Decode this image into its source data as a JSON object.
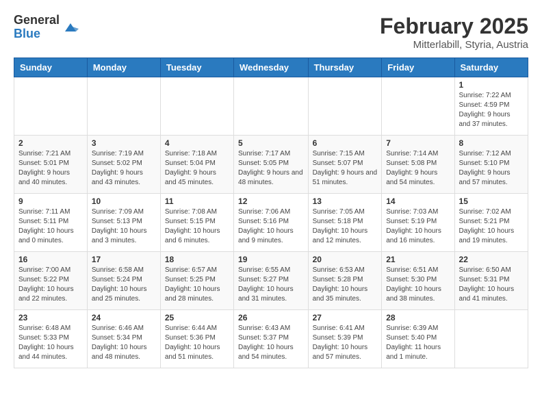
{
  "header": {
    "logo_general": "General",
    "logo_blue": "Blue",
    "month_year": "February 2025",
    "location": "Mitterlabill, Styria, Austria"
  },
  "weekdays": [
    "Sunday",
    "Monday",
    "Tuesday",
    "Wednesday",
    "Thursday",
    "Friday",
    "Saturday"
  ],
  "weeks": [
    [
      {
        "day": "",
        "info": ""
      },
      {
        "day": "",
        "info": ""
      },
      {
        "day": "",
        "info": ""
      },
      {
        "day": "",
        "info": ""
      },
      {
        "day": "",
        "info": ""
      },
      {
        "day": "",
        "info": ""
      },
      {
        "day": "1",
        "info": "Sunrise: 7:22 AM\nSunset: 4:59 PM\nDaylight: 9 hours and 37 minutes."
      }
    ],
    [
      {
        "day": "2",
        "info": "Sunrise: 7:21 AM\nSunset: 5:01 PM\nDaylight: 9 hours and 40 minutes."
      },
      {
        "day": "3",
        "info": "Sunrise: 7:19 AM\nSunset: 5:02 PM\nDaylight: 9 hours and 43 minutes."
      },
      {
        "day": "4",
        "info": "Sunrise: 7:18 AM\nSunset: 5:04 PM\nDaylight: 9 hours and 45 minutes."
      },
      {
        "day": "5",
        "info": "Sunrise: 7:17 AM\nSunset: 5:05 PM\nDaylight: 9 hours and 48 minutes."
      },
      {
        "day": "6",
        "info": "Sunrise: 7:15 AM\nSunset: 5:07 PM\nDaylight: 9 hours and 51 minutes."
      },
      {
        "day": "7",
        "info": "Sunrise: 7:14 AM\nSunset: 5:08 PM\nDaylight: 9 hours and 54 minutes."
      },
      {
        "day": "8",
        "info": "Sunrise: 7:12 AM\nSunset: 5:10 PM\nDaylight: 9 hours and 57 minutes."
      }
    ],
    [
      {
        "day": "9",
        "info": "Sunrise: 7:11 AM\nSunset: 5:11 PM\nDaylight: 10 hours and 0 minutes."
      },
      {
        "day": "10",
        "info": "Sunrise: 7:09 AM\nSunset: 5:13 PM\nDaylight: 10 hours and 3 minutes."
      },
      {
        "day": "11",
        "info": "Sunrise: 7:08 AM\nSunset: 5:15 PM\nDaylight: 10 hours and 6 minutes."
      },
      {
        "day": "12",
        "info": "Sunrise: 7:06 AM\nSunset: 5:16 PM\nDaylight: 10 hours and 9 minutes."
      },
      {
        "day": "13",
        "info": "Sunrise: 7:05 AM\nSunset: 5:18 PM\nDaylight: 10 hours and 12 minutes."
      },
      {
        "day": "14",
        "info": "Sunrise: 7:03 AM\nSunset: 5:19 PM\nDaylight: 10 hours and 16 minutes."
      },
      {
        "day": "15",
        "info": "Sunrise: 7:02 AM\nSunset: 5:21 PM\nDaylight: 10 hours and 19 minutes."
      }
    ],
    [
      {
        "day": "16",
        "info": "Sunrise: 7:00 AM\nSunset: 5:22 PM\nDaylight: 10 hours and 22 minutes."
      },
      {
        "day": "17",
        "info": "Sunrise: 6:58 AM\nSunset: 5:24 PM\nDaylight: 10 hours and 25 minutes."
      },
      {
        "day": "18",
        "info": "Sunrise: 6:57 AM\nSunset: 5:25 PM\nDaylight: 10 hours and 28 minutes."
      },
      {
        "day": "19",
        "info": "Sunrise: 6:55 AM\nSunset: 5:27 PM\nDaylight: 10 hours and 31 minutes."
      },
      {
        "day": "20",
        "info": "Sunrise: 6:53 AM\nSunset: 5:28 PM\nDaylight: 10 hours and 35 minutes."
      },
      {
        "day": "21",
        "info": "Sunrise: 6:51 AM\nSunset: 5:30 PM\nDaylight: 10 hours and 38 minutes."
      },
      {
        "day": "22",
        "info": "Sunrise: 6:50 AM\nSunset: 5:31 PM\nDaylight: 10 hours and 41 minutes."
      }
    ],
    [
      {
        "day": "23",
        "info": "Sunrise: 6:48 AM\nSunset: 5:33 PM\nDaylight: 10 hours and 44 minutes."
      },
      {
        "day": "24",
        "info": "Sunrise: 6:46 AM\nSunset: 5:34 PM\nDaylight: 10 hours and 48 minutes."
      },
      {
        "day": "25",
        "info": "Sunrise: 6:44 AM\nSunset: 5:36 PM\nDaylight: 10 hours and 51 minutes."
      },
      {
        "day": "26",
        "info": "Sunrise: 6:43 AM\nSunset: 5:37 PM\nDaylight: 10 hours and 54 minutes."
      },
      {
        "day": "27",
        "info": "Sunrise: 6:41 AM\nSunset: 5:39 PM\nDaylight: 10 hours and 57 minutes."
      },
      {
        "day": "28",
        "info": "Sunrise: 6:39 AM\nSunset: 5:40 PM\nDaylight: 11 hours and 1 minute."
      },
      {
        "day": "",
        "info": ""
      }
    ]
  ]
}
